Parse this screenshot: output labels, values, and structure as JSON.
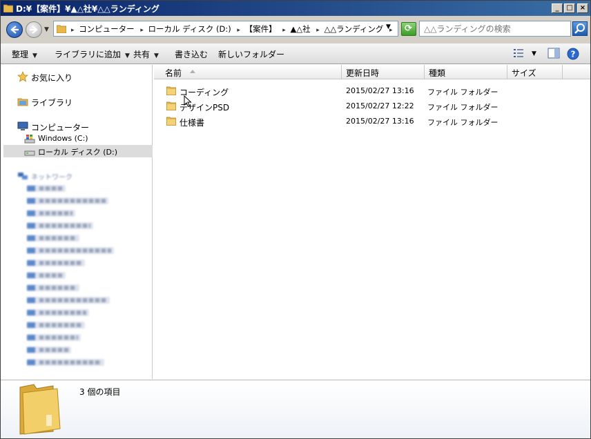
{
  "window": {
    "title": "D:¥【案件】¥▲△社¥△△ランディング"
  },
  "address": {
    "segments": [
      "コンピューター",
      "ローカル ディスク (D:)",
      "【案件】",
      "▲△社",
      "△△ランディング"
    ]
  },
  "search": {
    "placeholder": "△△ランディングの検索"
  },
  "toolbar": {
    "organize": "整理",
    "include_library": "ライブラリに追加",
    "share": "共有",
    "burn": "書き込む",
    "new_folder": "新しいフォルダー"
  },
  "nav": {
    "favorites": "お気に入り",
    "libraries": "ライブラリ",
    "computer": "コンピューター",
    "drive_c": "Windows (C:)",
    "drive_d": "ローカル ディスク (D:)",
    "network": "ネットワーク"
  },
  "columns": {
    "name": "名前",
    "date": "更新日時",
    "type": "種類",
    "size": "サイズ"
  },
  "files": [
    {
      "name": "コーディング",
      "date": "2015/02/27 13:16",
      "type": "ファイル フォルダー"
    },
    {
      "name": "デザインPSD",
      "date": "2015/02/27 12:22",
      "type": "ファイル フォルダー"
    },
    {
      "name": "仕様書",
      "date": "2015/02/27 13:16",
      "type": "ファイル フォルダー"
    }
  ],
  "details": {
    "count": "3 個の項目"
  },
  "colors": {
    "title_start": "#0a246a",
    "title_end": "#3a6ea5",
    "selection": "#dcdcdc",
    "folder": "#e8b84a"
  },
  "icons": {
    "folder": "folder-icon",
    "star": "star-icon",
    "library": "library-icon",
    "computer": "computer-icon",
    "drive": "drive-icon",
    "network": "network-icon",
    "help": "help-icon",
    "search": "search-icon"
  }
}
